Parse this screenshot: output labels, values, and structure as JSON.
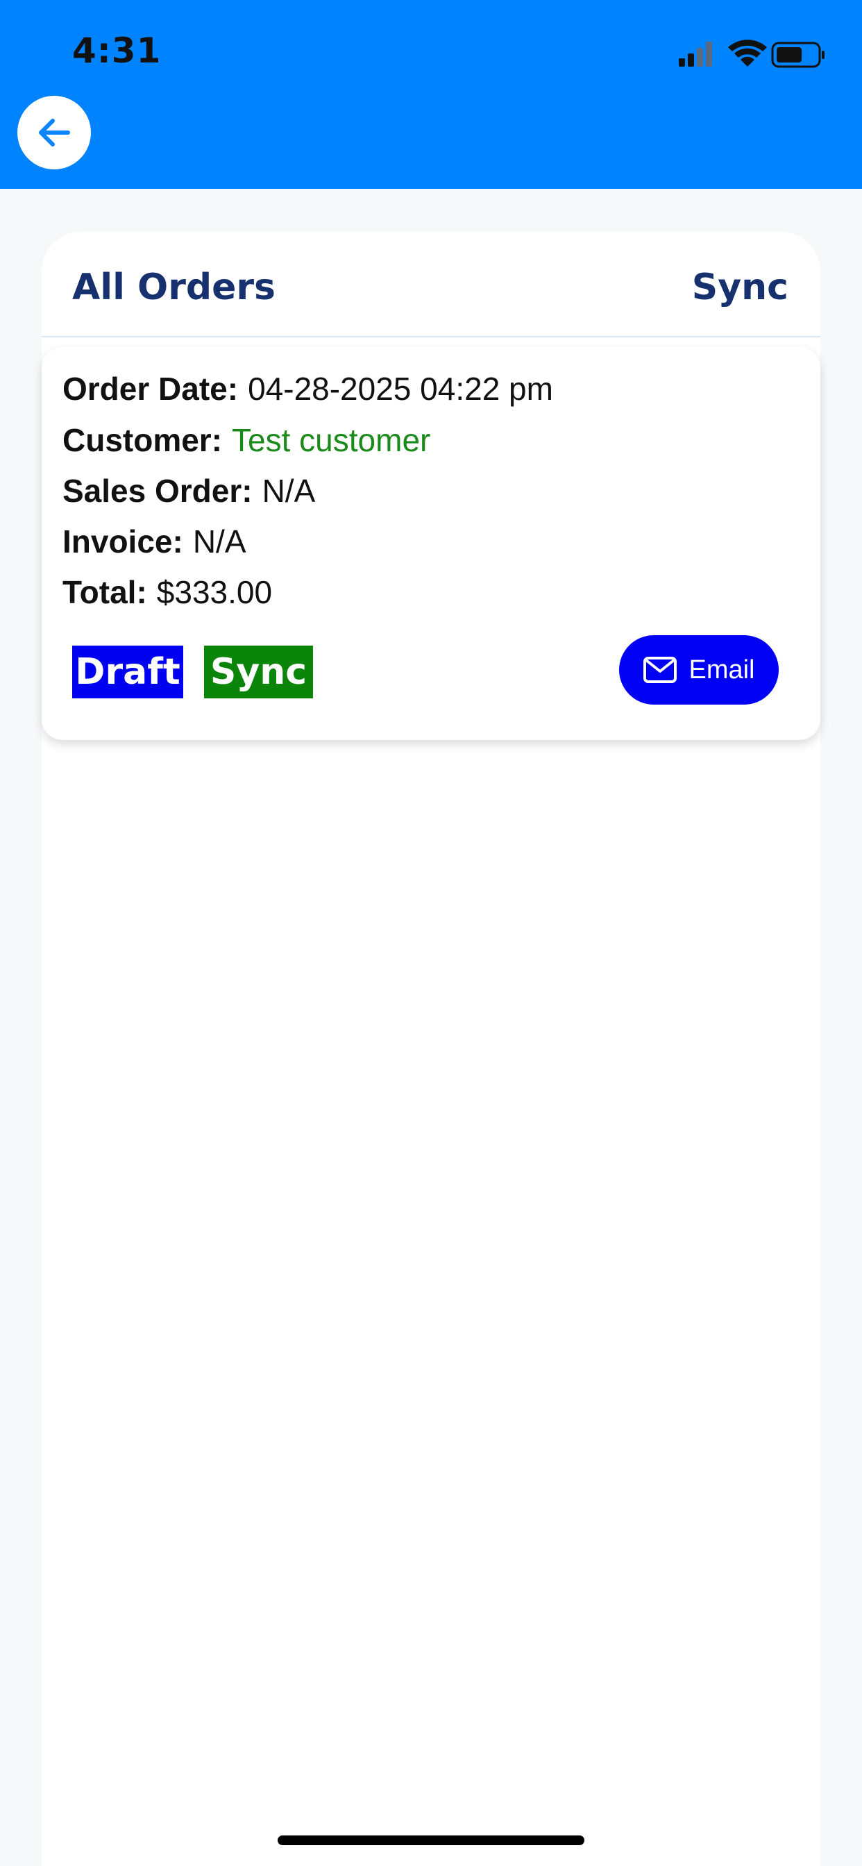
{
  "status_bar": {
    "time": "4:31"
  },
  "header": {
    "back_icon": "arrow-left-icon",
    "background_color": "#0083ff"
  },
  "panel": {
    "title": "All Orders",
    "sync_label": "Sync"
  },
  "orders": [
    {
      "date_label": "Order Date:",
      "date_value": "04-28-2025 04:22 pm",
      "customer_label": "Customer:",
      "customer_value": "Test customer",
      "sales_order_label": "Sales Order:",
      "sales_order_value": "N/A",
      "invoice_label": "Invoice:",
      "invoice_value": "N/A",
      "total_label": "Total:",
      "total_value": "$333.00",
      "status_badge": "Draft",
      "sync_badge": "Sync",
      "email_label": "Email",
      "email_icon": "mail-icon"
    }
  ]
}
